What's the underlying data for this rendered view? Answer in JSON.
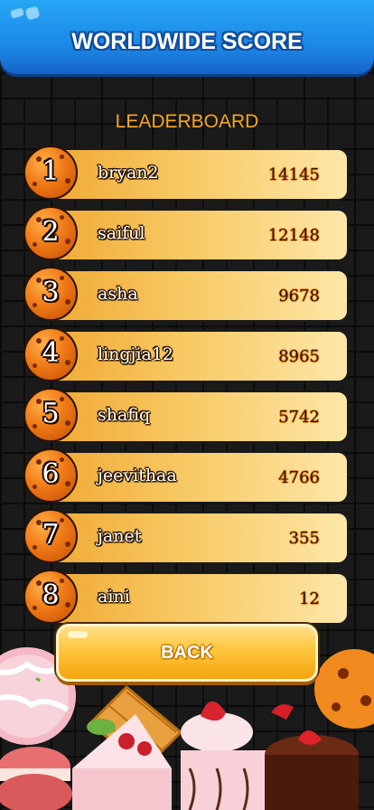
{
  "header": {
    "title": "WORLDWIDE SCORE"
  },
  "leaderboard": {
    "title": "LEADERBOARD",
    "rows": [
      {
        "rank": "1",
        "name": "bryan2",
        "score": "14145"
      },
      {
        "rank": "2",
        "name": "saiful",
        "score": "12148"
      },
      {
        "rank": "3",
        "name": "asha",
        "score": "9678"
      },
      {
        "rank": "4",
        "name": "lingjia12",
        "score": "8965"
      },
      {
        "rank": "5",
        "name": "shafiq",
        "score": "5742"
      },
      {
        "rank": "6",
        "name": "jeevithaa",
        "score": "4766"
      },
      {
        "rank": "7",
        "name": "janet",
        "score": "355"
      },
      {
        "rank": "8",
        "name": "aini",
        "score": "12"
      }
    ]
  },
  "back_button": {
    "label": "BACK"
  },
  "colors": {
    "header_blue": "#1b86e6",
    "accent_orange": "#f5a623",
    "button_yellow": "#ffc53c"
  }
}
